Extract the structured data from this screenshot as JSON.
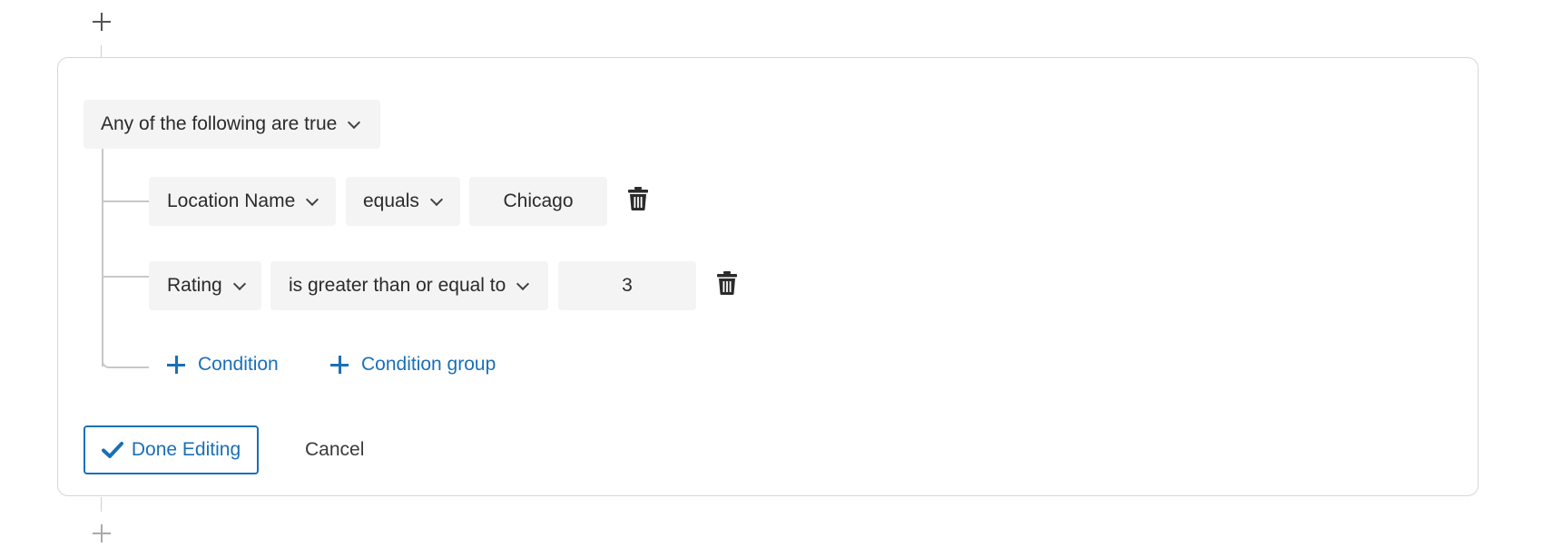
{
  "group": {
    "mode_label": "Any of the following are true"
  },
  "conditions": [
    {
      "field": "Location Name",
      "operator": "equals",
      "value": "Chicago"
    },
    {
      "field": "Rating",
      "operator": "is greater than or equal to",
      "value": "3"
    }
  ],
  "actions": {
    "add_condition": "Condition",
    "add_condition_group": "Condition group",
    "done_editing": "Done Editing",
    "cancel": "Cancel"
  },
  "colors": {
    "accent": "#1a6fb8",
    "pill_bg": "#f4f4f4",
    "border": "#d6d6d6"
  }
}
